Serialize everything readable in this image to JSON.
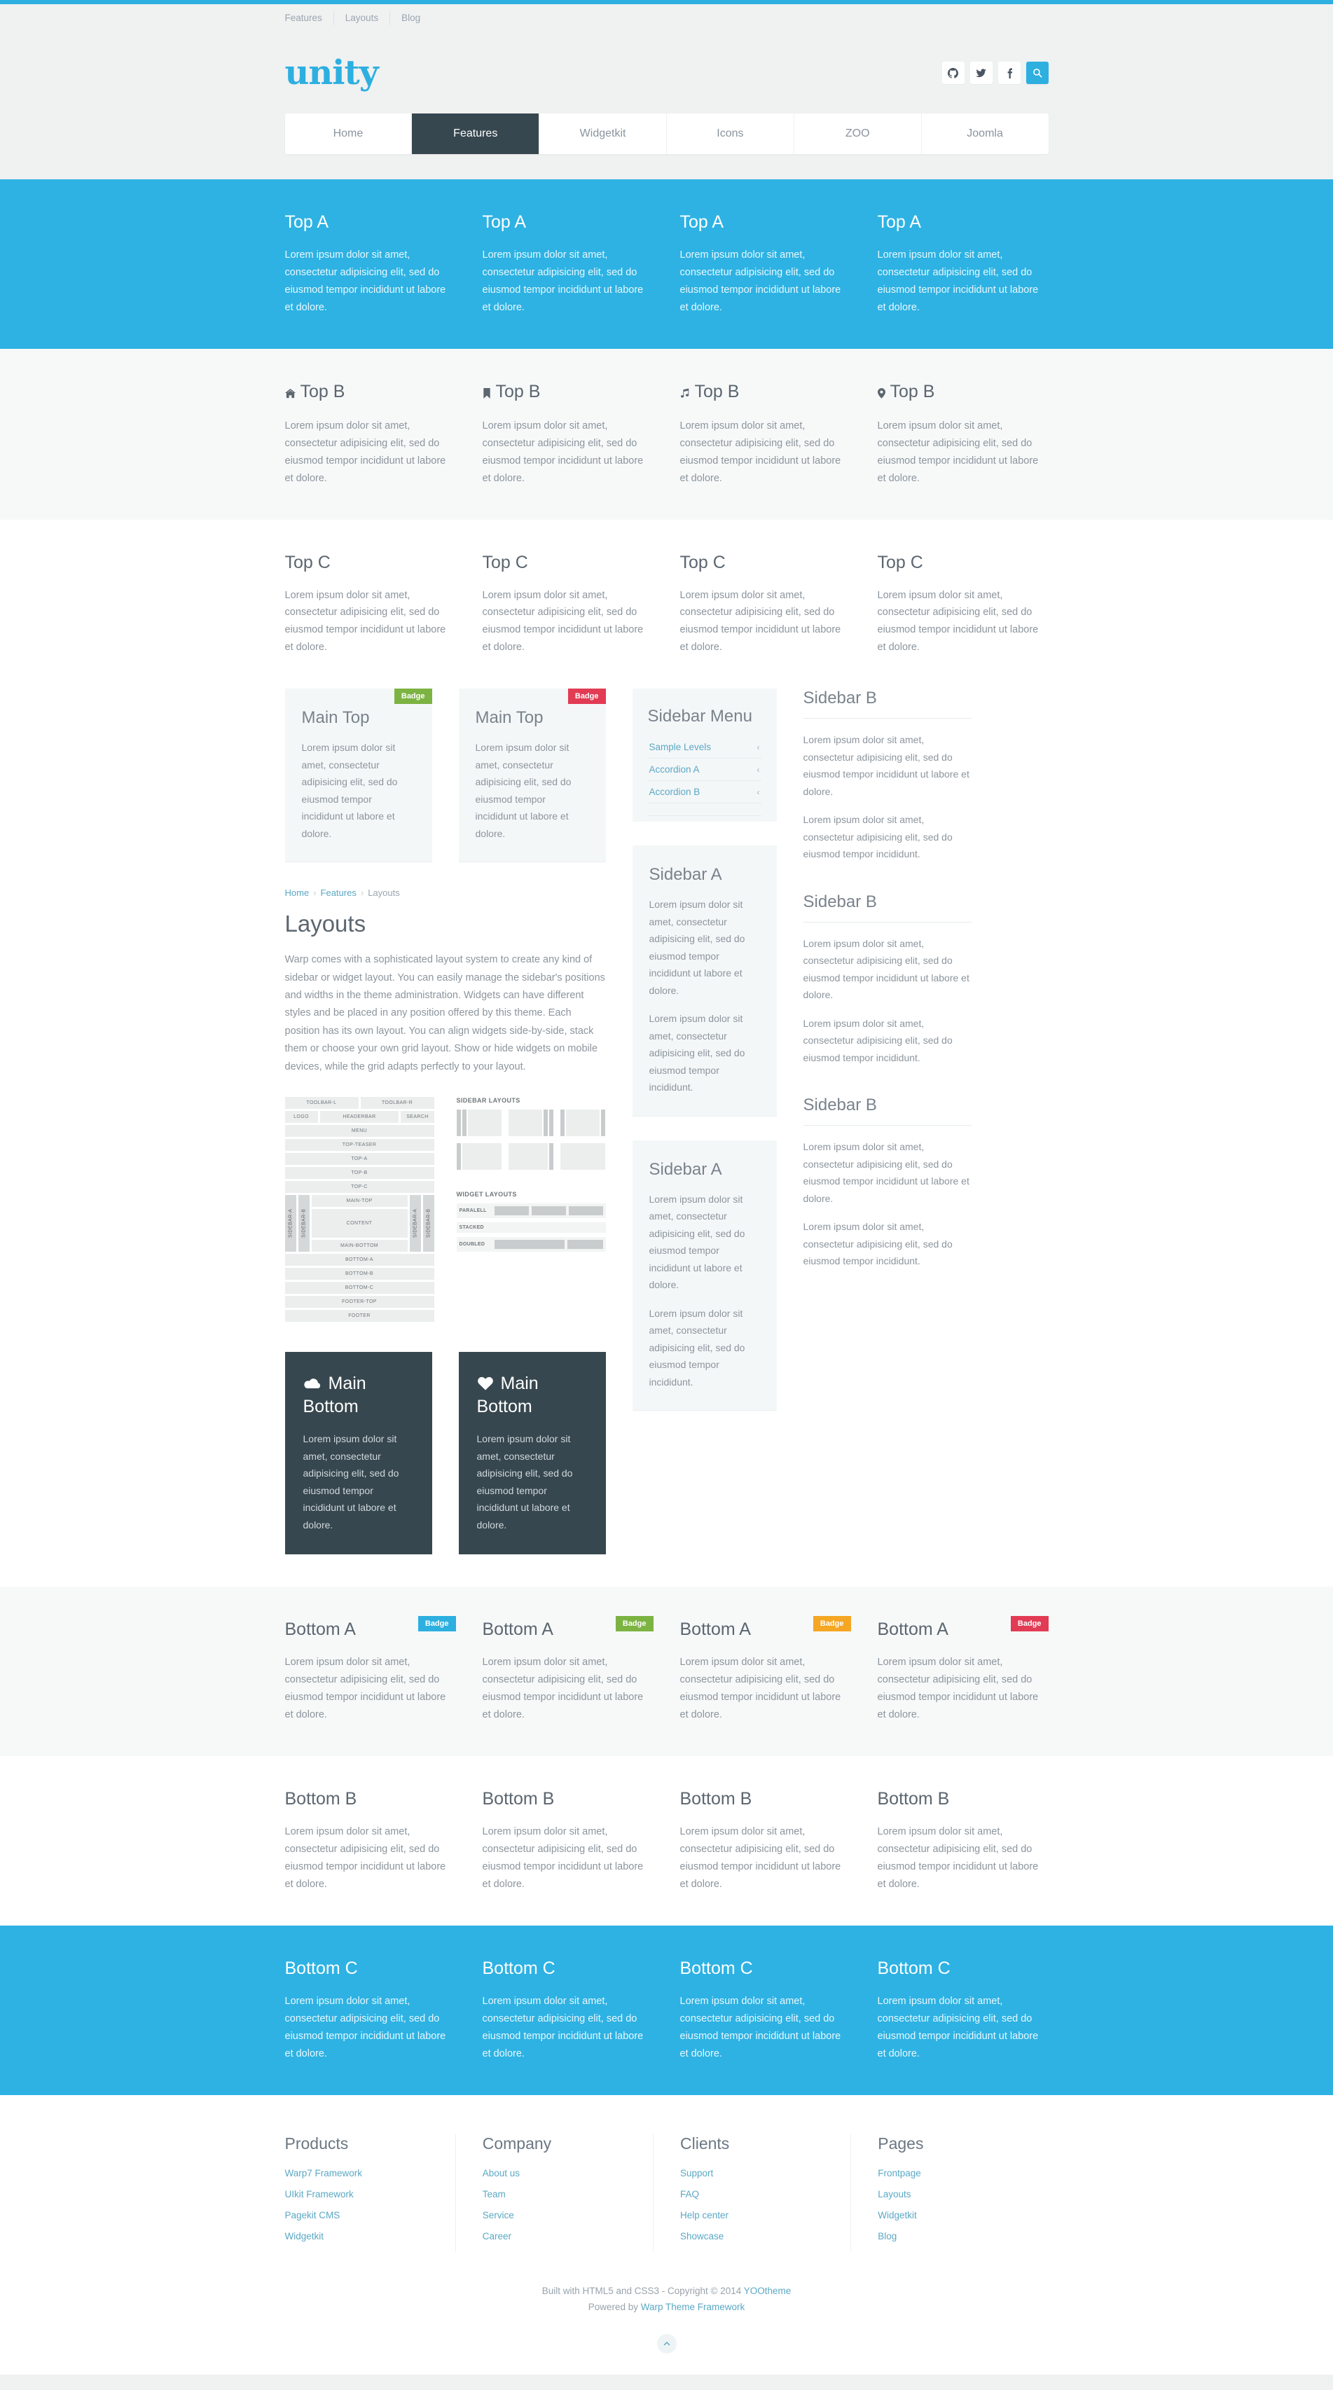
{
  "brand": {
    "logo_text": "unity",
    "accent": "#2dafe0",
    "dark": "#37474f"
  },
  "toolbar": {
    "links": [
      "Features",
      "Layouts",
      "Blog"
    ]
  },
  "social": [
    {
      "name": "github-icon",
      "label": "GitHub"
    },
    {
      "name": "twitter-icon",
      "label": "Twitter"
    },
    {
      "name": "facebook-icon",
      "label": "Facebook"
    },
    {
      "name": "search-icon",
      "label": "Search"
    }
  ],
  "nav": {
    "items": [
      {
        "label": "Home",
        "active": false
      },
      {
        "label": "Features",
        "active": true
      },
      {
        "label": "Widgetkit",
        "active": false
      },
      {
        "label": "Icons",
        "active": false
      },
      {
        "label": "ZOO",
        "active": false
      },
      {
        "label": "Joomla",
        "active": false
      }
    ]
  },
  "lorem_long": "Lorem ipsum dolor sit amet, consectetur adipisicing elit, sed do eiusmod tempor incididunt ut labore et dolore.",
  "lorem_short": "Lorem ipsum dolor sit amet, consectetur adipisicing elit, sed do eiusmod tempor incididunt ut labore et dolore.",
  "lorem_mid": "Lorem ipsum dolor sit amet, consectetur adipisicing elit, sed do eiusmod tempor incididunt.",
  "top_a": {
    "columns": [
      {
        "title": "Top A",
        "body": "Lorem ipsum dolor sit amet, consectetur adipisicing elit, sed do eiusmod tempor incididunt ut labore et dolore."
      },
      {
        "title": "Top A",
        "body": "Lorem ipsum dolor sit amet, consectetur adipisicing elit, sed do eiusmod tempor incididunt ut labore et dolore."
      },
      {
        "title": "Top A",
        "body": "Lorem ipsum dolor sit amet, consectetur adipisicing elit, sed do eiusmod tempor incididunt ut labore et dolore."
      },
      {
        "title": "Top A",
        "body": "Lorem ipsum dolor sit amet, consectetur adipisicing elit, sed do eiusmod tempor incididunt ut labore et dolore."
      }
    ]
  },
  "top_b": {
    "columns": [
      {
        "icon": "home-icon",
        "title": "Top B",
        "body": "Lorem ipsum dolor sit amet, consectetur adipisicing elit, sed do eiusmod tempor incididunt ut labore et dolore."
      },
      {
        "icon": "bookmark-icon",
        "title": "Top B",
        "body": "Lorem ipsum dolor sit amet, consectetur adipisicing elit, sed do eiusmod tempor incididunt ut labore et dolore."
      },
      {
        "icon": "music-icon",
        "title": "Top B",
        "body": "Lorem ipsum dolor sit amet, consectetur adipisicing elit, sed do eiusmod tempor incididunt ut labore et dolore."
      },
      {
        "icon": "location-pin-icon",
        "title": "Top B",
        "body": "Lorem ipsum dolor sit amet, consectetur adipisicing elit, sed do eiusmod tempor incididunt ut labore et dolore."
      }
    ]
  },
  "top_c": {
    "columns": [
      {
        "title": "Top C",
        "body": "Lorem ipsum dolor sit amet, consectetur adipisicing elit, sed do eiusmod tempor incididunt ut labore et dolore."
      },
      {
        "title": "Top C",
        "body": "Lorem ipsum dolor sit amet, consectetur adipisicing elit, sed do eiusmod tempor incididunt ut labore et dolore."
      },
      {
        "title": "Top C",
        "body": "Lorem ipsum dolor sit amet, consectetur adipisicing elit, sed do eiusmod tempor incididunt ut labore et dolore."
      },
      {
        "title": "Top C",
        "body": "Lorem ipsum dolor sit amet, consectetur adipisicing elit, sed do eiusmod tempor incididunt ut labore et dolore."
      }
    ]
  },
  "main_top": {
    "cards": [
      {
        "title": "Main Top",
        "badge": "Badge",
        "badge_color": "green",
        "body": "Lorem ipsum dolor sit amet, consectetur adipisicing elit, sed do eiusmod tempor incididunt ut labore et dolore."
      },
      {
        "title": "Main Top",
        "badge": "Badge",
        "badge_color": "red",
        "body": "Lorem ipsum dolor sit amet, consectetur adipisicing elit, sed do eiusmod tempor incididunt ut labore et dolore."
      }
    ]
  },
  "sidebar_menu": {
    "title": "Sidebar Menu",
    "items": [
      {
        "label": "Sample Levels",
        "chevron": "‹"
      },
      {
        "label": "Accordion A",
        "chevron": "‹"
      },
      {
        "label": "Accordion B",
        "chevron": "‹"
      }
    ]
  },
  "sidebar_a": [
    {
      "title": "Sidebar A",
      "p1": "Lorem ipsum dolor sit amet, consectetur adipisicing elit, sed do eiusmod tempor incididunt ut labore et dolore.",
      "p2": "Lorem ipsum dolor sit amet, consectetur adipisicing elit, sed do eiusmod tempor incididunt."
    },
    {
      "title": "Sidebar A",
      "p1": "Lorem ipsum dolor sit amet, consectetur adipisicing elit, sed do eiusmod tempor incididunt ut labore et dolore.",
      "p2": "Lorem ipsum dolor sit amet, consectetur adipisicing elit, sed do eiusmod tempor incididunt."
    }
  ],
  "sidebar_b": [
    {
      "title": "Sidebar B",
      "p1": "Lorem ipsum dolor sit amet, consectetur adipisicing elit, sed do eiusmod tempor incididunt ut labore et dolore.",
      "p2": "Lorem ipsum dolor sit amet, consectetur adipisicing elit, sed do eiusmod tempor incididunt."
    },
    {
      "title": "Sidebar B",
      "p1": "Lorem ipsum dolor sit amet, consectetur adipisicing elit, sed do eiusmod tempor incididunt ut labore et dolore.",
      "p2": "Lorem ipsum dolor sit amet, consectetur adipisicing elit, sed do eiusmod tempor incididunt."
    },
    {
      "title": "Sidebar B",
      "p1": "Lorem ipsum dolor sit amet, consectetur adipisicing elit, sed do eiusmod tempor incididunt ut labore et dolore.",
      "p2": "Lorem ipsum dolor sit amet, consectetur adipisicing elit, sed do eiusmod tempor incididunt."
    }
  ],
  "article": {
    "breadcrumb": [
      {
        "label": "Home",
        "link": true
      },
      {
        "label": "Features",
        "link": true
      },
      {
        "label": "Layouts",
        "link": false
      }
    ],
    "separator": "›",
    "title": "Layouts",
    "body": "Warp comes with a sophisticated layout system to create any kind of sidebar or widget layout. You can easily manage the sidebar's positions and widths in the theme administration. Widgets can have different styles and be placed in any position offered by this theme. Each position has its own layout. You can align widgets side-by-side, stack them or choose your own grid layout. Show or hide widgets on mobile devices, while the grid adapts perfectly to your layout."
  },
  "layout_diagram": {
    "toolbar_row": [
      "TOOLBAR-L",
      "TOOLBAR-R"
    ],
    "header_row": [
      "LOGO",
      "HEADERBAR",
      "SEARCH"
    ],
    "full_rows_top": [
      "MENU",
      "TOP-TEASER",
      "TOP-A",
      "TOP-B",
      "TOP-C"
    ],
    "left_sides": [
      "SIDEBAR-A",
      "SIDEBAR-B"
    ],
    "center_stack": [
      "MAIN-TOP",
      "CONTENT",
      "MAIN-BOTTOM"
    ],
    "right_sides": [
      "SIDEBAR-A",
      "SIDEBAR-B"
    ],
    "full_rows_bottom": [
      "BOTTOM-A",
      "BOTTOM-B",
      "BOTTOM-C",
      "FOOTER-TOP",
      "FOOTER"
    ]
  },
  "sidebar_layouts": {
    "title": "SIDEBAR LAYOUTS"
  },
  "widget_layouts": {
    "title": "WIDGET LAYOUTS",
    "rows": [
      {
        "label": "PARALELL",
        "cells": 3,
        "mode": "parallel"
      },
      {
        "label": "STACKED",
        "cells": 2,
        "mode": "stacked"
      },
      {
        "label": "DOUBLED",
        "cells": 2,
        "mode": "doubled"
      }
    ]
  },
  "main_bottom": {
    "cards": [
      {
        "icon": "cloud-icon",
        "title": "Main Bottom",
        "body": "Lorem ipsum dolor sit amet, consectetur adipisicing elit, sed do eiusmod tempor incididunt ut labore et dolore."
      },
      {
        "icon": "heart-icon",
        "title": "Main Bottom",
        "body": "Lorem ipsum dolor sit amet, consectetur adipisicing elit, sed do eiusmod tempor incididunt ut labore et dolore."
      }
    ]
  },
  "bottom_a": {
    "columns": [
      {
        "title": "Bottom A",
        "badge": "Badge",
        "badge_color": "blue",
        "body": "Lorem ipsum dolor sit amet, consectetur adipisicing elit, sed do eiusmod tempor incididunt ut labore et dolore."
      },
      {
        "title": "Bottom A",
        "badge": "Badge",
        "badge_color": "green",
        "body": "Lorem ipsum dolor sit amet, consectetur adipisicing elit, sed do eiusmod tempor incididunt ut labore et dolore."
      },
      {
        "title": "Bottom A",
        "badge": "Badge",
        "badge_color": "orange",
        "body": "Lorem ipsum dolor sit amet, consectetur adipisicing elit, sed do eiusmod tempor incididunt ut labore et dolore."
      },
      {
        "title": "Bottom A",
        "badge": "Badge",
        "badge_color": "red",
        "body": "Lorem ipsum dolor sit amet, consectetur adipisicing elit, sed do eiusmod tempor incididunt ut labore et dolore."
      }
    ]
  },
  "bottom_b": {
    "columns": [
      {
        "title": "Bottom B",
        "body": "Lorem ipsum dolor sit amet, consectetur adipisicing elit, sed do eiusmod tempor incididunt ut labore et dolore."
      },
      {
        "title": "Bottom B",
        "body": "Lorem ipsum dolor sit amet, consectetur adipisicing elit, sed do eiusmod tempor incididunt ut labore et dolore."
      },
      {
        "title": "Bottom B",
        "body": "Lorem ipsum dolor sit amet, consectetur adipisicing elit, sed do eiusmod tempor incididunt ut labore et dolore."
      },
      {
        "title": "Bottom B",
        "body": "Lorem ipsum dolor sit amet, consectetur adipisicing elit, sed do eiusmod tempor incididunt ut labore et dolore."
      }
    ]
  },
  "bottom_c": {
    "columns": [
      {
        "title": "Bottom C",
        "body": "Lorem ipsum dolor sit amet, consectetur adipisicing elit, sed do eiusmod tempor incididunt ut labore et dolore."
      },
      {
        "title": "Bottom C",
        "body": "Lorem ipsum dolor sit amet, consectetur adipisicing elit, sed do eiusmod tempor incididunt ut labore et dolore."
      },
      {
        "title": "Bottom C",
        "body": "Lorem ipsum dolor sit amet, consectetur adipisicing elit, sed do eiusmod tempor incididunt ut labore et dolore."
      },
      {
        "title": "Bottom C",
        "body": "Lorem ipsum dolor sit amet, consectetur adipisicing elit, sed do eiusmod tempor incididunt ut labore et dolore."
      }
    ]
  },
  "footer": {
    "columns": [
      {
        "title": "Products",
        "links": [
          "Warp7 Framework",
          "UIkit Framework",
          "Pagekit CMS",
          "Widgetkit"
        ]
      },
      {
        "title": "Company",
        "links": [
          "About us",
          "Team",
          "Service",
          "Career"
        ]
      },
      {
        "title": "Clients",
        "links": [
          "Support",
          "FAQ",
          "Help center",
          "Showcase"
        ]
      },
      {
        "title": "Pages",
        "links": [
          "Frontpage",
          "Layouts",
          "Widgetkit",
          "Blog"
        ]
      }
    ],
    "copyright_prefix": "Built with HTML5 and CSS3 - Copyright © 2014 ",
    "copyright_link": "YOOtheme",
    "powered_prefix": "Powered by ",
    "powered_link": "Warp Theme Framework",
    "to_top": "^"
  }
}
